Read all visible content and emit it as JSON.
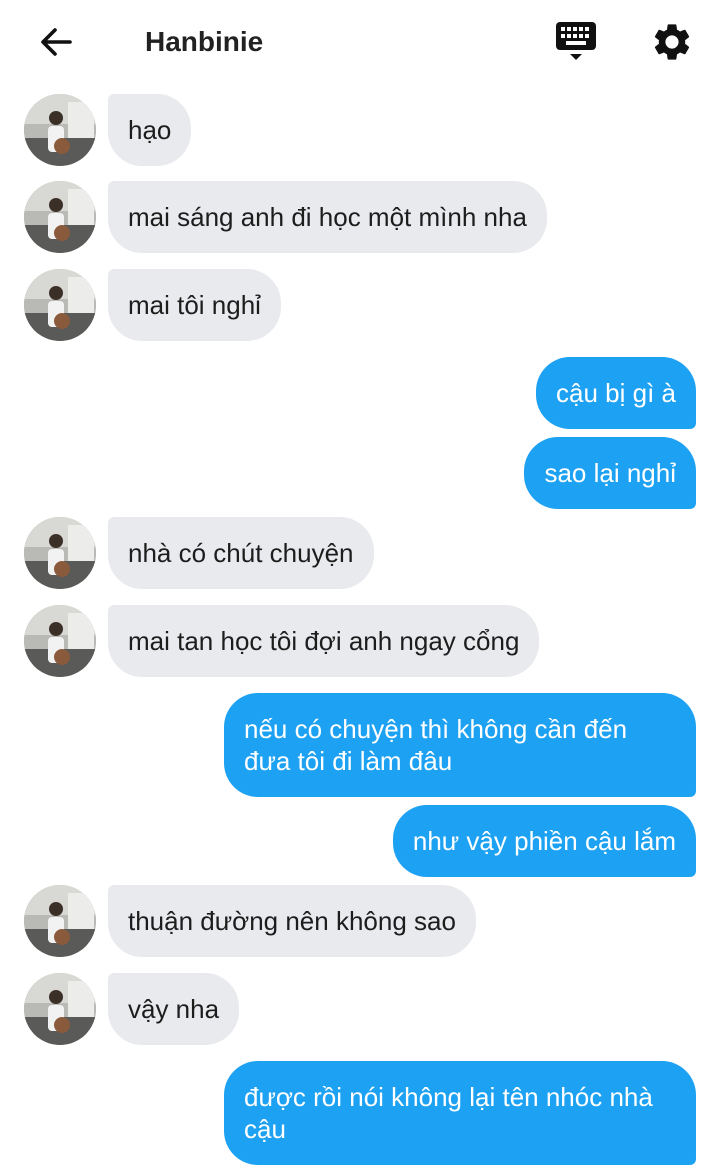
{
  "header": {
    "title": "Hanbinie",
    "back_icon": "arrow-left-icon",
    "keyboard_icon": "keyboard-icon",
    "settings_icon": "gear-icon"
  },
  "colors": {
    "incoming_bubble": "#e8eaed",
    "outgoing_bubble": "#1da1f2",
    "outgoing_text": "#ffffff"
  },
  "messages": [
    {
      "from": "them",
      "text": "hạo"
    },
    {
      "from": "them",
      "text": "mai sáng anh đi học một mình nha"
    },
    {
      "from": "them",
      "text": "mai tôi nghỉ"
    },
    {
      "from": "me",
      "text": "cậu bị gì à"
    },
    {
      "from": "me",
      "text": "sao lại nghỉ"
    },
    {
      "from": "them",
      "text": "nhà có chút chuyện"
    },
    {
      "from": "them",
      "text": "mai tan học tôi đợi anh ngay cổng"
    },
    {
      "from": "me",
      "text": "nếu có chuyện thì không cần đến đưa tôi đi làm đâu"
    },
    {
      "from": "me",
      "text": "như vậy phiền cậu lắm"
    },
    {
      "from": "them",
      "text": "thuận đường nên không sao"
    },
    {
      "from": "them",
      "text": "vậy nha"
    },
    {
      "from": "me",
      "text": "được rồi nói không lại tên nhóc nhà cậu"
    }
  ]
}
